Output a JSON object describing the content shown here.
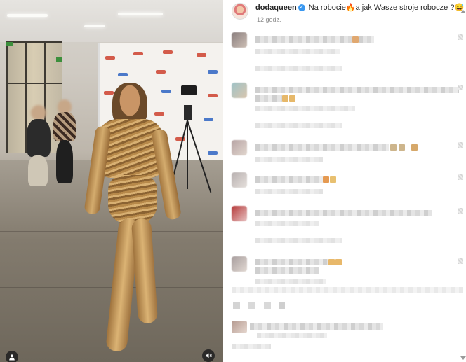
{
  "post": {
    "username": "dodaqueen",
    "verified_glyph": "✓",
    "caption": "Na robocie🔥a jak Wasze stroje robocze ?😅",
    "time_ago": "12 godz."
  },
  "media": {
    "mute_icon": "speaker-muted-icon",
    "user_icon": "user-tag-icon"
  },
  "colors": {
    "accent": "#3897f0",
    "gold": "#b98a4a",
    "secondary_text": "#8e8e8e"
  }
}
